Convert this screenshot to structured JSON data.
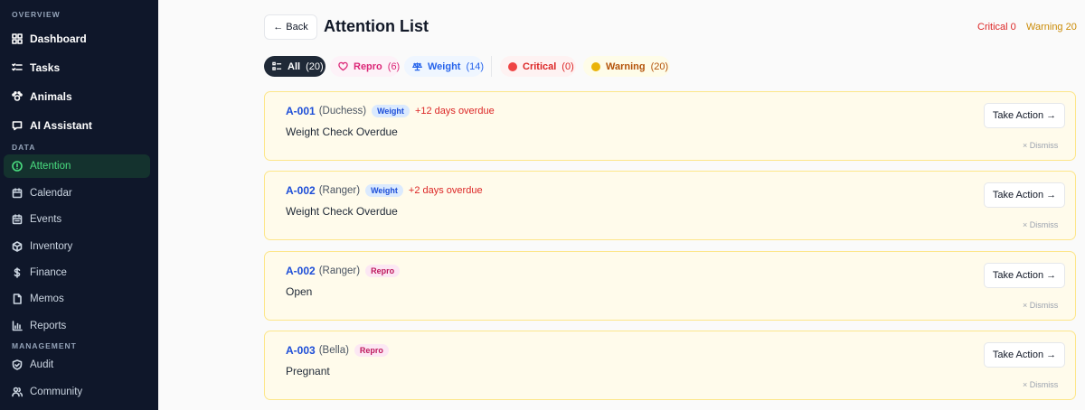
{
  "sidebar": {
    "sections": {
      "overview": "OVERVIEW",
      "data": "DATA",
      "management": "MANAGEMENT"
    },
    "overview_items": [
      {
        "label": "Dashboard",
        "icon": "grid-icon"
      },
      {
        "label": "Tasks",
        "icon": "checklist-icon"
      },
      {
        "label": "Animals",
        "icon": "paw-icon"
      },
      {
        "label": "AI Assistant",
        "icon": "chat-icon"
      }
    ],
    "data_items": [
      {
        "label": "Attention",
        "icon": "alert-circle-icon",
        "active": true
      },
      {
        "label": "Calendar",
        "icon": "calendar-icon"
      },
      {
        "label": "Events",
        "icon": "calendar-event-icon"
      },
      {
        "label": "Inventory",
        "icon": "box-icon"
      },
      {
        "label": "Finance",
        "icon": "dollar-icon"
      },
      {
        "label": "Memos",
        "icon": "file-icon"
      },
      {
        "label": "Reports",
        "icon": "bar-chart-icon"
      }
    ],
    "management_items": [
      {
        "label": "Audit",
        "icon": "shield-icon"
      },
      {
        "label": "Community",
        "icon": "users-icon"
      }
    ]
  },
  "header": {
    "back_label": "← Back",
    "title": "Attention List",
    "critical_summary": "Critical 0",
    "warning_summary": "Warning 20"
  },
  "filters": {
    "all": {
      "label": "All",
      "count": "(20)"
    },
    "repro": {
      "label": "Repro",
      "count": "(6)"
    },
    "weight": {
      "label": "Weight",
      "count": "(14)"
    },
    "critical": {
      "label": "Critical",
      "count": "(0)"
    },
    "warning": {
      "label": "Warning",
      "count": "(20)"
    }
  },
  "colors": {
    "critical": "#dc2626",
    "warning": "#ca8a04",
    "accent": "#4ade80",
    "sidebar_bg": "#0f172a"
  },
  "cards": [
    {
      "id": "A-001",
      "name": "(Duchess)",
      "tag": "Weight",
      "overdue": "+12 days overdue",
      "description": "Weight Check Overdue",
      "action": "Take Action →",
      "dismiss": "× Dismiss"
    },
    {
      "id": "A-002",
      "name": "(Ranger)",
      "tag": "Weight",
      "overdue": "+2 days overdue",
      "description": "Weight Check Overdue",
      "action": "Take Action →",
      "dismiss": "× Dismiss"
    },
    {
      "id": "A-002",
      "name": "(Ranger)",
      "tag": "Repro",
      "overdue": "",
      "description": "Open",
      "action": "Take Action →",
      "dismiss": "× Dismiss"
    },
    {
      "id": "A-003",
      "name": "(Bella)",
      "tag": "Repro",
      "overdue": "",
      "description": "Pregnant",
      "action": "Take Action →",
      "dismiss": "× Dismiss"
    }
  ]
}
